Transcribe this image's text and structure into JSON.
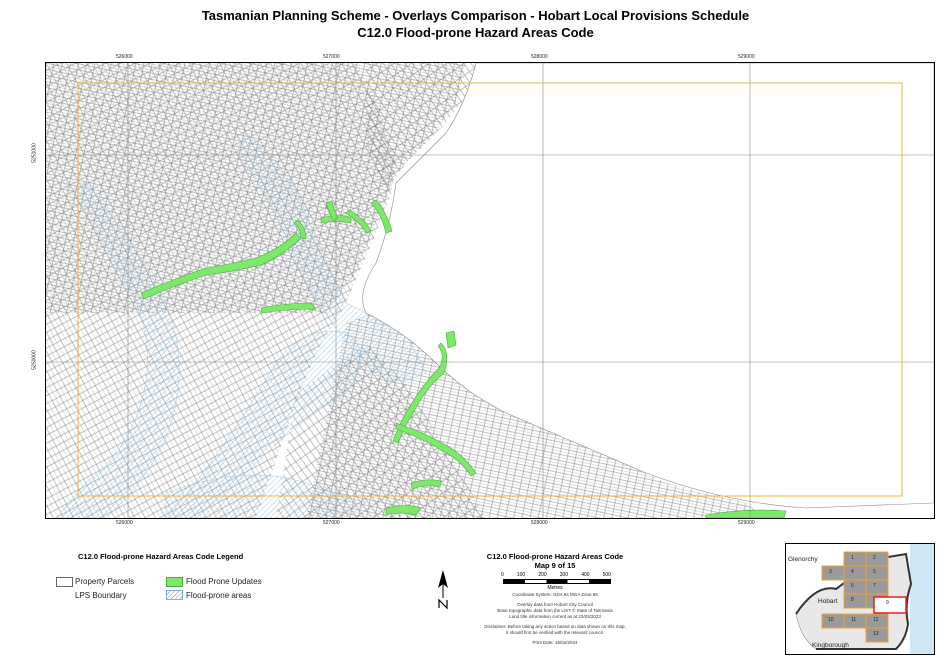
{
  "header": {
    "title_line1": "Tasmanian Planning Scheme - Overlays Comparison - Hobart Local Provisions Schedule",
    "title_line2": "C12.0 Flood-prone Hazard Areas Code"
  },
  "map": {
    "easting_labels": [
      "526000",
      "527000",
      "528000",
      "529000"
    ],
    "northing_labels": [
      "5251000",
      "5250000"
    ],
    "colors": {
      "flood_prone_updates": "#7de96b",
      "flood_prone_areas": "#9fc8e6",
      "lps_boundary": "#f0b43c",
      "parcels": "#666666"
    }
  },
  "legend": {
    "title": "C12.0 Flood-prone Hazard Areas Code Legend",
    "items": [
      {
        "label": "Property Parcels",
        "icon": "parcel-swatch"
      },
      {
        "label": "LPS Boundary",
        "icon": "lps-boundary-line"
      },
      {
        "label": "Flood Prone Updates",
        "icon": "green-fill-swatch"
      },
      {
        "label": "Flood-prone areas",
        "icon": "blue-hatch-swatch"
      }
    ]
  },
  "map_info": {
    "code_title": "C12.0 Flood-prone Hazard Areas Code",
    "map_number": "Map 9 of 15",
    "scale_ticks": [
      "0",
      "100",
      "200",
      "300",
      "400",
      "500"
    ],
    "scale_unit": "Metres",
    "coordinate_system": "Coordinate System: GDA 94 MGA Zone 55",
    "source_line1": "Overlay data from Hobart City Council",
    "source_line2": "Base topographic data from the LIST © State of Tasmania",
    "source_line3": "Land title information current as at 22/03/2023",
    "disclaimer_line1": "Disclaimer: Before taking any action based on data shown on this map,",
    "disclaimer_line2": "it should first be verified with the relevant council.",
    "print_date": "Print Date: 16/02/2024",
    "north_arrow": "north-arrow-icon"
  },
  "inset": {
    "labels": [
      "Glenorchy",
      "Hobart",
      "Kingborough"
    ],
    "tiles": [
      "1",
      "2",
      "3",
      "4",
      "5",
      "6",
      "7",
      "8",
      "9",
      "10",
      "11",
      "12",
      "13"
    ],
    "highlighted_tile": "9"
  }
}
